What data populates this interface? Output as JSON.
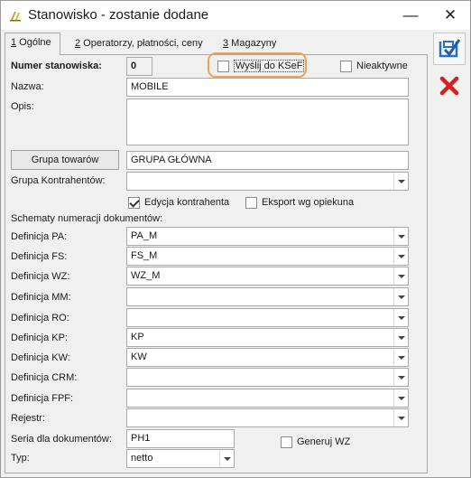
{
  "window": {
    "title": "Stanowisko - zostanie dodane",
    "minimize_glyph": "—",
    "close_glyph": "✕"
  },
  "tabs": [
    {
      "hotkey": "1",
      "label": " Ogólne"
    },
    {
      "hotkey": "2",
      "label": " Operatorzy, płatności, ceny"
    },
    {
      "hotkey": "3",
      "label": " Magazyny"
    }
  ],
  "side_toolbar": {
    "save_icon": "save-check-icon",
    "cancel_icon": "red-x-icon",
    "accent_blue": "#2a6fc0",
    "accent_red": "#d42020"
  },
  "form": {
    "numer_label": "Numer stanowiska:",
    "numer_value": "0",
    "wyslij_label": "Wyślij do KSeF",
    "nieaktywne_label": "Nieaktywne",
    "nazwa_label": "Nazwa:",
    "nazwa_value": "MOBILE",
    "opis_label": "Opis:",
    "opis_value": "",
    "grupa_towarow_button": "Grupa towarów",
    "grupa_towarow_value": "GRUPA GŁÓWNA",
    "grupa_kontrahentow_label": "Grupa Kontrahentów:",
    "grupa_kontrahentow_value": "",
    "edycja_kontrahenta_label": "Edycja kontrahenta",
    "edycja_kontrahenta_checked": true,
    "eksport_label": "Eksport wg opiekuna",
    "schematy_label": "Schematy numeracji dokumentów:",
    "definicje": [
      {
        "label": "Definicja PA:",
        "value": "PA_M"
      },
      {
        "label": "Definicja FS:",
        "value": "FS_M"
      },
      {
        "label": "Definicja WZ:",
        "value": "WZ_M"
      },
      {
        "label": "Definicja MM:",
        "value": ""
      },
      {
        "label": "Definicja RO:",
        "value": ""
      },
      {
        "label": "Definicja KP:",
        "value": "KP"
      },
      {
        "label": "Definicja KW:",
        "value": "KW"
      },
      {
        "label": "Definicja CRM:",
        "value": ""
      },
      {
        "label": "Definicja FPF:",
        "value": ""
      }
    ],
    "rejestr_label": "Rejestr:",
    "rejestr_value": "",
    "seria_label": "Seria dla dokumentów:",
    "seria_value": "PH1",
    "generuj_wz_label": "Generuj WZ",
    "typ_label": "Typ:",
    "typ_value": "netto",
    "highlight_color": "#f0a050"
  }
}
